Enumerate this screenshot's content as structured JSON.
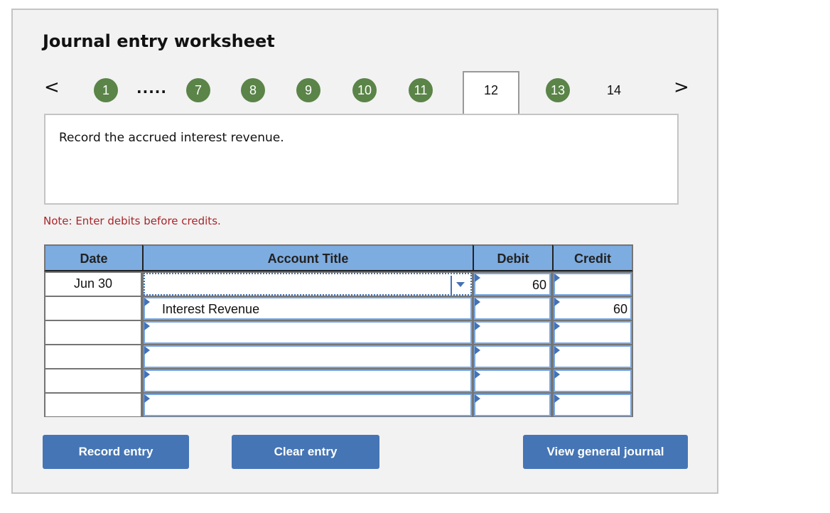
{
  "worksheet": {
    "title": "Journal entry worksheet",
    "nav": {
      "prev_icon": "chevron-left-icon",
      "next_icon": "chevron-right-icon",
      "prev_glyph": "<",
      "next_glyph": ">",
      "ellipsis": ".....",
      "steps": [
        {
          "label": "1",
          "state": "completed"
        },
        {
          "label": "7",
          "state": "completed"
        },
        {
          "label": "8",
          "state": "completed"
        },
        {
          "label": "9",
          "state": "completed"
        },
        {
          "label": "10",
          "state": "completed"
        },
        {
          "label": "11",
          "state": "completed"
        },
        {
          "label": "12",
          "state": "active"
        },
        {
          "label": "13",
          "state": "completed"
        },
        {
          "label": "14",
          "state": "pending"
        }
      ]
    },
    "instruction": "Record the accrued interest revenue.",
    "note": "Note: Enter debits before credits.",
    "colors": {
      "completed_step": "#5a8448",
      "header_bg": "#7dace0",
      "button_bg": "#4575b5",
      "note_text": "#a8262a"
    },
    "table": {
      "headers": {
        "date": "Date",
        "account": "Account Title",
        "debit": "Debit",
        "credit": "Credit"
      },
      "rows": [
        {
          "date": "Jun 30",
          "account": "",
          "debit": "60",
          "credit": ""
        },
        {
          "date": "",
          "account": "Interest Revenue",
          "debit": "",
          "credit": "60"
        },
        {
          "date": "",
          "account": "",
          "debit": "",
          "credit": ""
        },
        {
          "date": "",
          "account": "",
          "debit": "",
          "credit": ""
        },
        {
          "date": "",
          "account": "",
          "debit": "",
          "credit": ""
        },
        {
          "date": "",
          "account": "",
          "debit": "",
          "credit": ""
        }
      ]
    },
    "buttons": {
      "record": "Record entry",
      "clear": "Clear entry",
      "view": "View general journal"
    }
  }
}
